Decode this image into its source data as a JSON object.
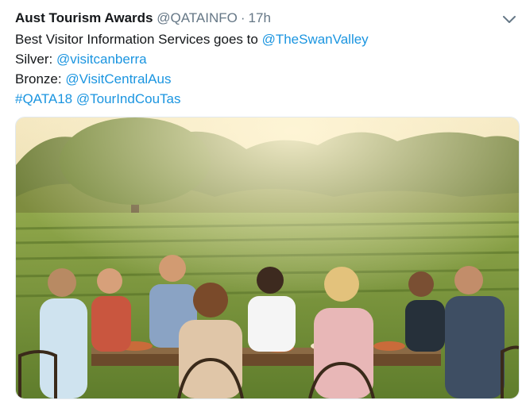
{
  "tweet": {
    "author_name": "Aust Tourism Awards",
    "author_handle": "@QATAINFO",
    "separator": "·",
    "timestamp": "17h",
    "text": {
      "line1_prefix": "Best Visitor Information Services goes to ",
      "line1_mention": "@TheSwanValley",
      "line2_prefix": "Silver: ",
      "line2_mention": "@visitcanberra",
      "line3_prefix": "Bronze: ",
      "line3_mention": "@VisitCentralAus",
      "line4_hashtag": "#QATA18",
      "line4_mention": "@TourIndCouTas"
    }
  },
  "icons": {
    "caret": "chevron-down-icon"
  },
  "colors": {
    "link": "#1b95e0",
    "secondary": "#657786",
    "text": "#14171a"
  }
}
